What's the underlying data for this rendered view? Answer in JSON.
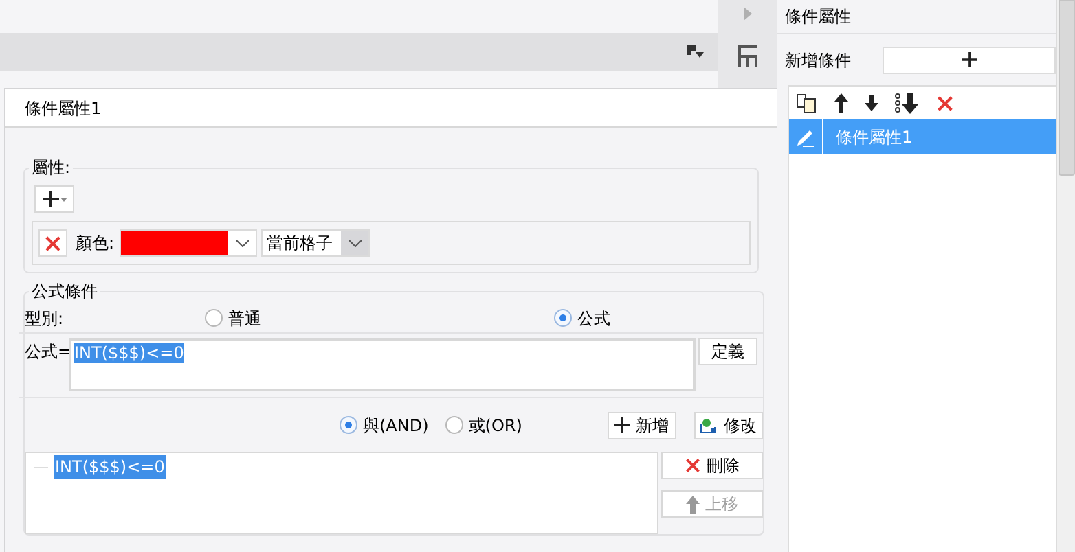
{
  "dialog": {
    "title": "條件屬性1",
    "attributes": {
      "legend": "屬性:",
      "rows": [
        {
          "kind": "color",
          "label": "顏色:",
          "color": "#ff0000",
          "scope": "當前格子"
        }
      ]
    },
    "formula_condition": {
      "legend": "公式條件",
      "type_label": "型別:",
      "types": [
        {
          "label": "普通",
          "selected": false
        },
        {
          "label": "公式",
          "selected": true
        }
      ],
      "formula_label": "公式=",
      "formula_value": "INT($$$)<=0",
      "define_button": "定義",
      "logic": [
        {
          "label": "與(AND)",
          "selected": true
        },
        {
          "label": "或(OR)",
          "selected": false
        }
      ],
      "add_button": "新增",
      "modify_button": "修改",
      "conditions": [
        {
          "text": "INT($$$)<=0",
          "selected": true
        }
      ],
      "delete_button": {
        "label": "刪除",
        "disabled": false
      },
      "up_button": {
        "label": "上移",
        "disabled": true
      }
    }
  },
  "side_panel": {
    "title": "條件屬性",
    "add_label": "新增條件",
    "items": [
      {
        "label": "條件屬性1",
        "selected": true
      }
    ]
  }
}
